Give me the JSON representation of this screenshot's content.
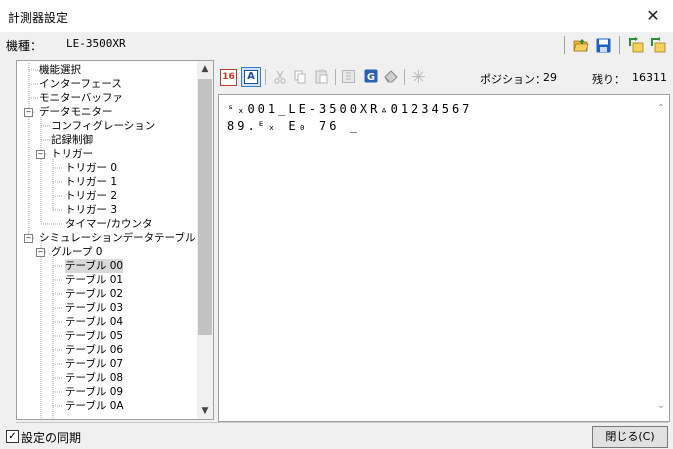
{
  "window": {
    "title": "計測器設定",
    "close_glyph": "✕"
  },
  "model": {
    "label": "機種：",
    "value": "LE-3500XR"
  },
  "toolbar_top": {
    "icons": [
      "folder-open-icon",
      "save-icon",
      "export-icon",
      "import-icon"
    ]
  },
  "tree": {
    "items": [
      {
        "label": "機能選択"
      },
      {
        "label": "インターフェース"
      },
      {
        "label": "モニターバッファ"
      },
      {
        "label": "データモニター"
      },
      {
        "label": "コンフィグレーション"
      },
      {
        "label": "記録制御"
      },
      {
        "label": "トリガー"
      },
      {
        "label": "トリガー 0"
      },
      {
        "label": "トリガー 1"
      },
      {
        "label": "トリガー 2"
      },
      {
        "label": "トリガー 3"
      },
      {
        "label": "タイマー/カウンタ"
      },
      {
        "label": "シミュレーションデータテーブル"
      },
      {
        "label": "グループ 0"
      },
      {
        "label": "テーブル 00"
      },
      {
        "label": "テーブル 01"
      },
      {
        "label": "テーブル 02"
      },
      {
        "label": "テーブル 03"
      },
      {
        "label": "テーブル 04"
      },
      {
        "label": "テーブル 05"
      },
      {
        "label": "テーブル 06"
      },
      {
        "label": "テーブル 07"
      },
      {
        "label": "テーブル 08"
      },
      {
        "label": "テーブル 09"
      },
      {
        "label": "テーブル 0A"
      }
    ],
    "expander_minus": "−"
  },
  "editor_toolbar": {
    "hex_btn": "16",
    "ascii_btn": "A",
    "position_label": "ポジション：",
    "position_value": "29",
    "remaining_label": "残り：",
    "remaining_value": "16311"
  },
  "editor": {
    "line1": "ˢₓ001_LE-3500XR▵01234567",
    "line2": "89.ᴱₓ E₀ 76 _"
  },
  "footer": {
    "checkbox_label": "設定の同期",
    "checkbox_checked": true,
    "check_glyph": "✓",
    "close_button": "閉じる(C)"
  }
}
